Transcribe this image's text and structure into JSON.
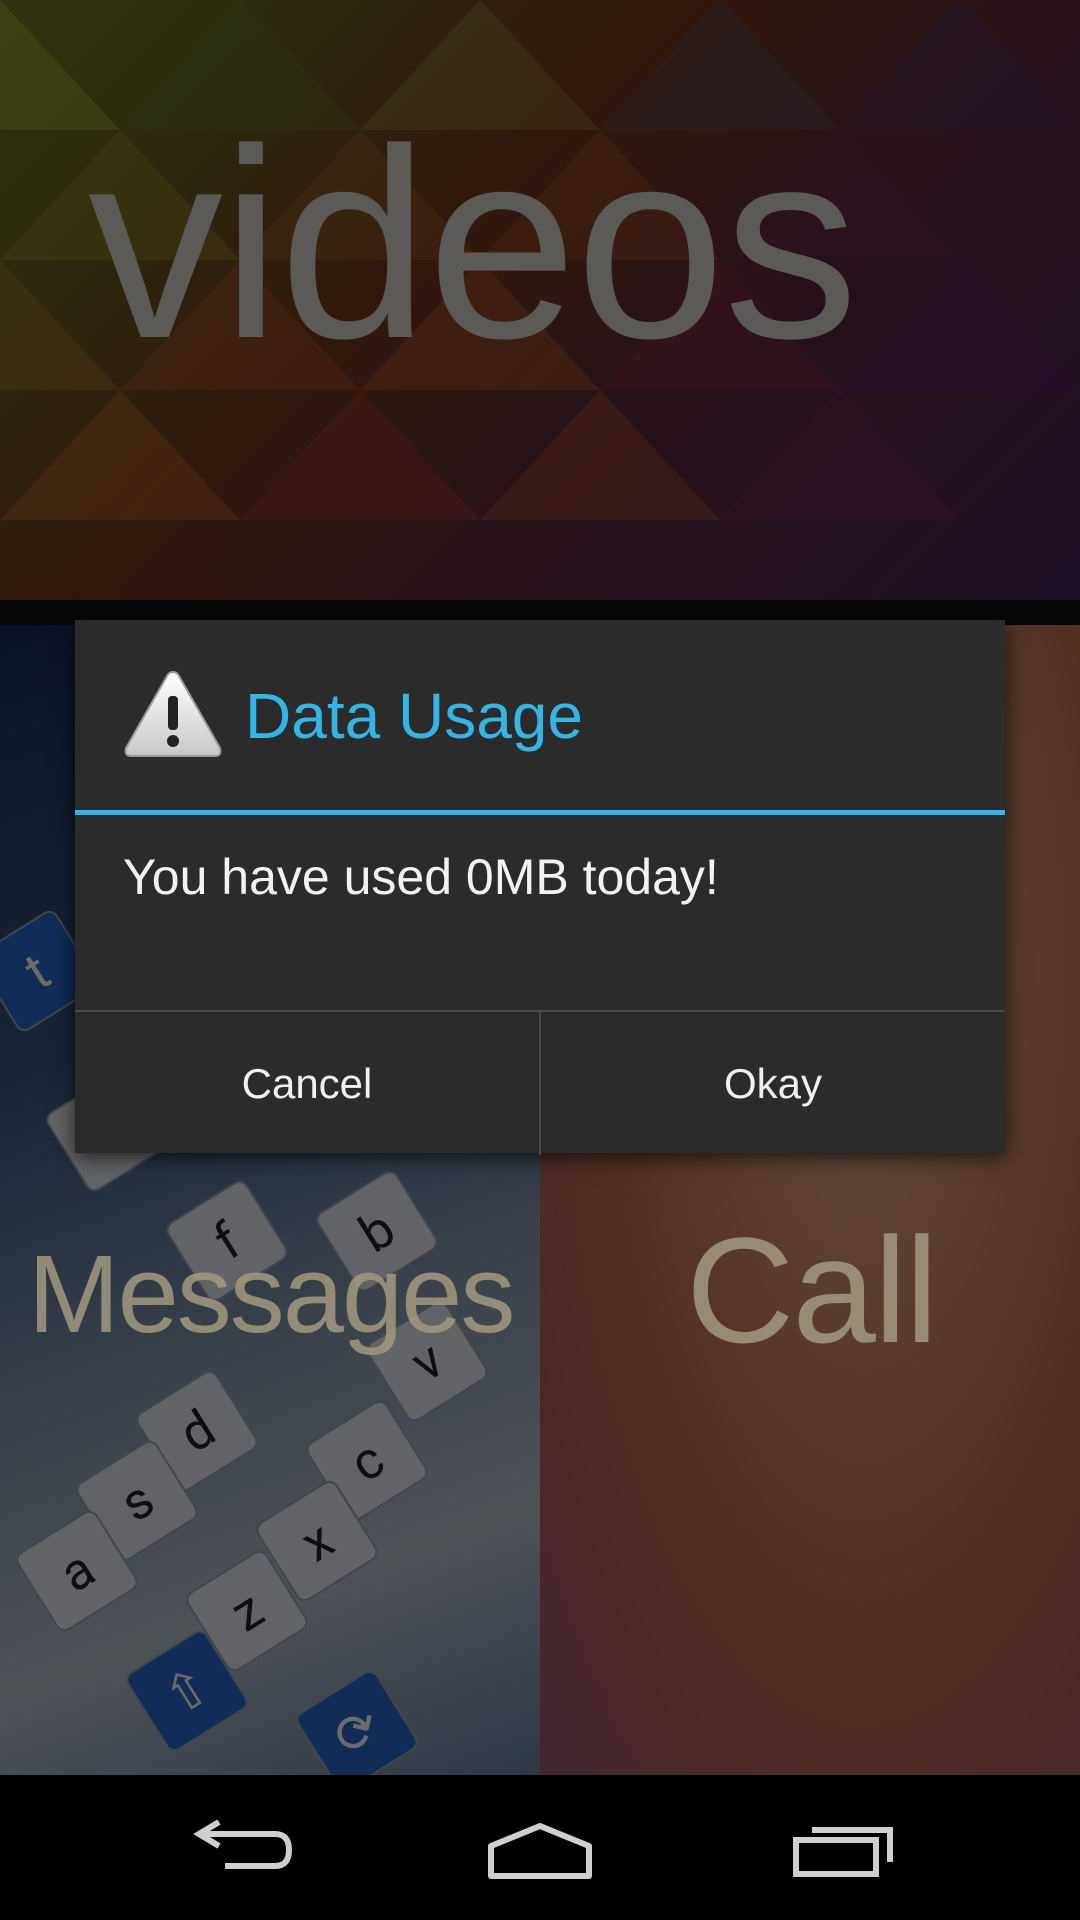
{
  "background": {
    "videos_label": "videos",
    "messages_label": "Messages",
    "call_label": "Call"
  },
  "dialog": {
    "icon": "warning-icon",
    "title": "Data Usage",
    "message": "You have used 0MB today!",
    "cancel_label": "Cancel",
    "okay_label": "Okay",
    "accent_color": "#33b5e5"
  },
  "nav": {
    "back_icon": "back-icon",
    "home_icon": "home-icon",
    "recents_icon": "recents-icon"
  }
}
